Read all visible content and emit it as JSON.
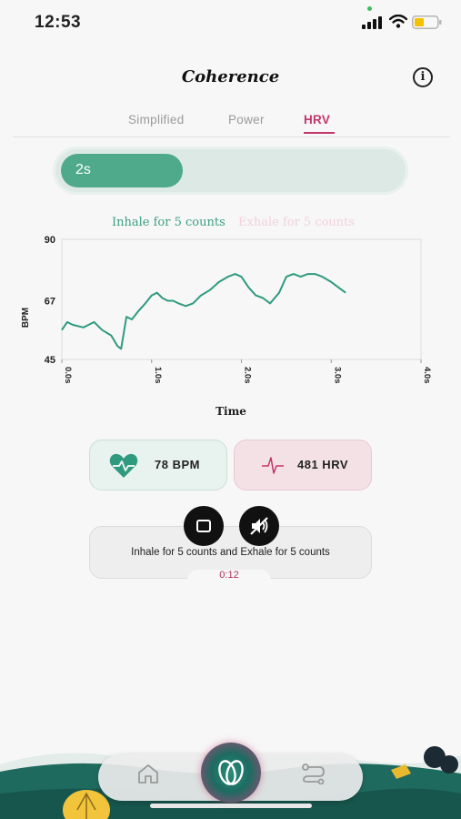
{
  "status_bar": {
    "time": "12:53"
  },
  "header": {
    "title": "Coherence",
    "info_glyph": "i"
  },
  "tabs": [
    {
      "label": "Simplified",
      "active": false
    },
    {
      "label": "Power",
      "active": false
    },
    {
      "label": "HRV",
      "active": true
    }
  ],
  "progress": {
    "label": "2s",
    "fraction": 0.36
  },
  "breathing": {
    "inhale": "Inhale for 5 counts",
    "exhale": "Exhale for 5 counts"
  },
  "chart_data": {
    "type": "line",
    "xlabel": "Time",
    "ylabel": "BPM",
    "xlim": [
      0,
      4
    ],
    "ylim": [
      45,
      90
    ],
    "x_ticks": [
      "0.0s",
      "1.0s",
      "2.0s",
      "3.0s",
      "4.0s"
    ],
    "y_ticks": [
      "45",
      "67",
      "90"
    ],
    "grid": false,
    "series": [
      {
        "color": "#2f9a7e",
        "x": [
          0.0,
          0.06,
          0.12,
          0.24,
          0.3,
          0.36,
          0.45,
          0.55,
          0.62,
          0.66,
          0.72,
          0.78,
          0.85,
          0.93,
          1.0,
          1.06,
          1.12,
          1.18,
          1.24,
          1.3,
          1.38,
          1.46,
          1.55,
          1.65,
          1.75,
          1.85,
          1.93,
          2.0,
          2.08,
          2.16,
          2.24,
          2.32,
          2.42,
          2.5,
          2.58,
          2.66,
          2.74,
          2.82,
          2.9,
          3.0,
          3.08,
          3.16
        ],
        "values": [
          56,
          59,
          58,
          57,
          58,
          59,
          56,
          54,
          50,
          49,
          61,
          60,
          63,
          66,
          69,
          70,
          68,
          67,
          67,
          66,
          65,
          66,
          69,
          71,
          74,
          76,
          77,
          76,
          72,
          69,
          68,
          66,
          70,
          76,
          77,
          76,
          77,
          77,
          76,
          74,
          72,
          70
        ]
      }
    ]
  },
  "stats": {
    "bpm": "78 BPM",
    "hrv": "481 HRV"
  },
  "session": {
    "instruction": "Inhale for 5 counts and Exhale for 5 counts",
    "timer": "0:12"
  },
  "colors": {
    "accent_green": "#4faa8c",
    "accent_pink": "#c4356a",
    "line": "#2f9a7e"
  },
  "icons": {
    "stop": "stop-icon",
    "mute": "sound-off-icon",
    "heart": "heart-icon",
    "pulse": "pulse-icon",
    "home": "home-icon",
    "route": "route-icon"
  }
}
